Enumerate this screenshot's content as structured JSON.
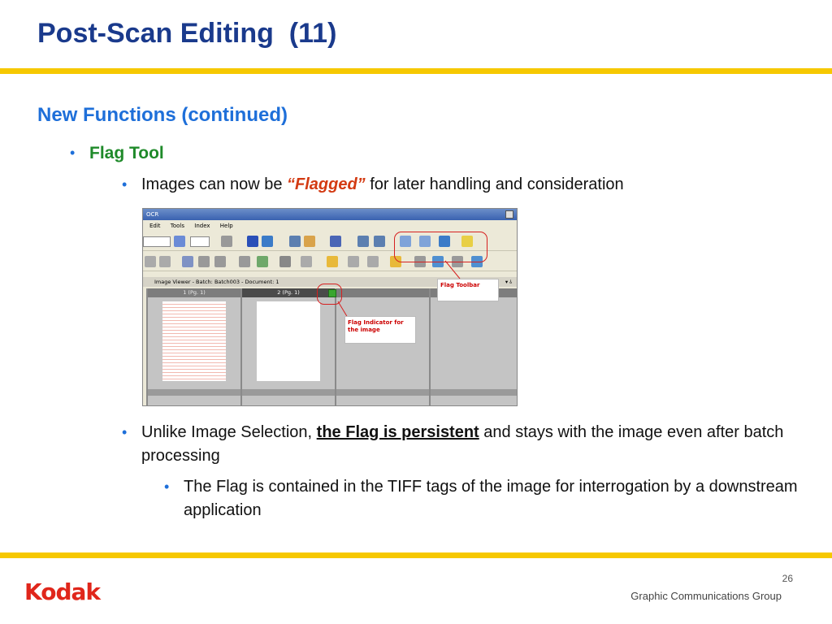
{
  "slide": {
    "title": "Post-Scan Editing  (11)",
    "subtitle": "New Functions (continued)",
    "bullet1": "Flag Tool",
    "bullet2_pre": "Images can now be ",
    "bullet2_em": "“Flagged”",
    "bullet2_post": " for later handling and consideration",
    "bullet3_pre": "Unlike Image Selection, ",
    "bullet3_em": "the Flag is persistent",
    "bullet3_post": " and stays with the image even after batch processing",
    "bullet4": "The Flag is contained in the TIFF tags of the image for interrogation by a downstream application",
    "page_number": "26",
    "footer_right": "Graphic Communications Group",
    "logo_text": "Kodak"
  },
  "screenshot": {
    "window_title": "OCR",
    "menu": [
      "Edit",
      "Tools",
      "Index",
      "Help"
    ],
    "viewer_title": "Image Viewer - Batch: Batch003 - Document: 1",
    "columns": [
      "1 (Pg. 1)",
      "2 (Pg. 1)",
      "",
      ""
    ],
    "callout_toolbar": "Flag Toolbar",
    "callout_indicator": "Flag Indicator for the image"
  },
  "colors": {
    "title": "#1a3a8c",
    "subtitle": "#1e6fd9",
    "flag_tool": "#1f8a2a",
    "flagged": "#d33a12",
    "rule": "#f6c800",
    "logo": "#e0261b",
    "callout_ring": "#d62020"
  }
}
